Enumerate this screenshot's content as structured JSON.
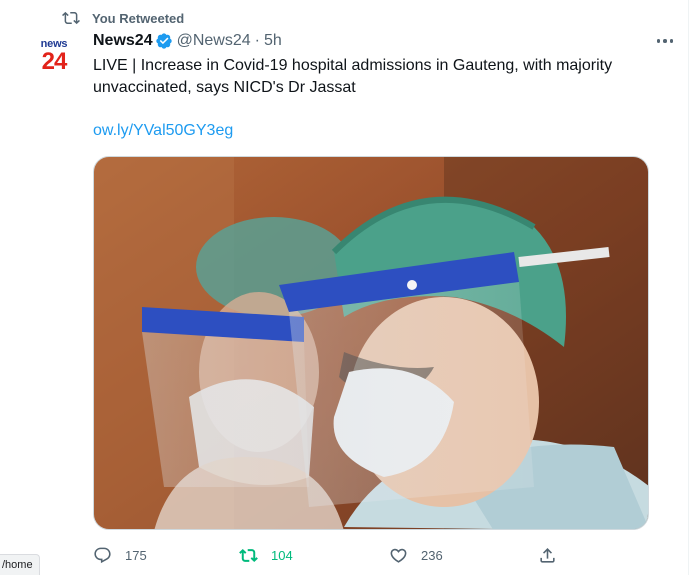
{
  "retweet": {
    "label": "You Retweeted",
    "icon": "retweet-icon"
  },
  "author": {
    "avatar_top": "news",
    "avatar_num": "24",
    "name": "News24",
    "handle": "@News24",
    "separator": "·",
    "time": "5h",
    "verified_icon": "verified-badge-icon"
  },
  "tweet": {
    "text": "LIVE | Increase in Covid-19 hospital admissions in Gauteng, with majority\nunvaccinated, says NICD's Dr Jassat",
    "link": "ow.ly/YVal50GY3eg"
  },
  "actions": {
    "reply_count": "175",
    "retweet_count": "104",
    "like_count": "236"
  },
  "status_bar": {
    "url": "/home"
  },
  "colors": {
    "accent": "#1d9bf0",
    "retweet_active": "#00ba7c",
    "muted": "#536471",
    "brand_red": "#e2231a",
    "brand_blue": "#1f3a93"
  }
}
